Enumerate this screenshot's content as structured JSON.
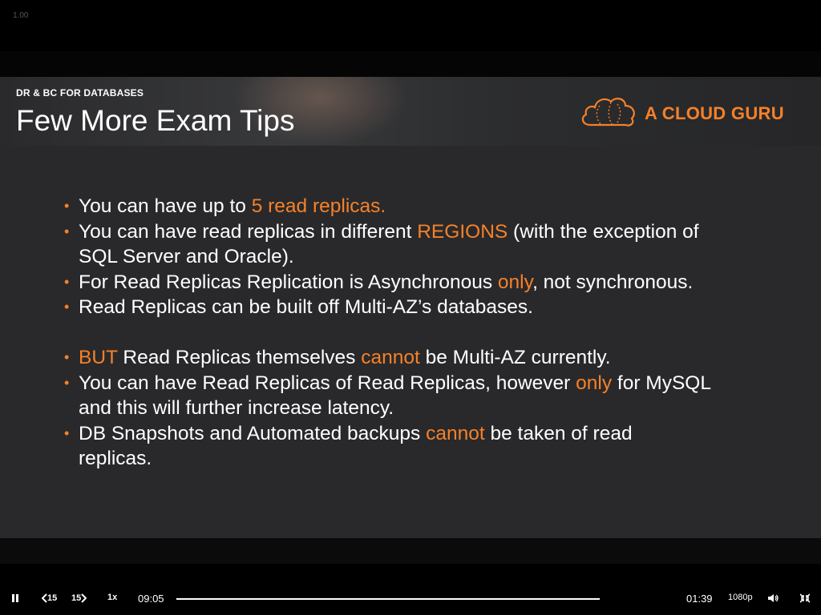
{
  "player": {
    "zoom": "1.00",
    "speed": "1x",
    "elapsed": "09:05",
    "remaining": "01:39",
    "quality": "1080p",
    "skip_back_label": "15",
    "skip_forward_label": "15"
  },
  "slide": {
    "section": "DR & BC FOR DATABASES",
    "title": "Few More Exam Tips",
    "logo_text": "A CLOUD GURU",
    "bullets": [
      {
        "segments": [
          {
            "text": "You can have up to ",
            "hl": false
          },
          {
            "text": "5 read replicas.",
            "hl": true
          }
        ]
      },
      {
        "segments": [
          {
            "text": "You can have read replicas in different ",
            "hl": false
          },
          {
            "text": "REGIONS",
            "hl": true
          },
          {
            "text": " (with the exception of",
            "hl": false
          }
        ]
      },
      {
        "segments": [
          {
            "text": "SQL Server and Oracle).",
            "hl": false
          }
        ],
        "continuation": true
      },
      {
        "segments": [
          {
            "text": "For Read Replicas Replication is Asynchronous ",
            "hl": false
          },
          {
            "text": "only",
            "hl": true
          },
          {
            "text": ", not synchronous.",
            "hl": false
          }
        ]
      },
      {
        "segments": [
          {
            "text": "Read Replicas can be built off Multi-AZ’s databases.",
            "hl": false
          }
        ]
      },
      {
        "segments": [
          {
            "text": "BUT",
            "hl": true
          },
          {
            "text": " Read Replicas themselves ",
            "hl": false
          },
          {
            "text": "cannot",
            "hl": true
          },
          {
            "text": " be Multi-AZ currently.",
            "hl": false
          }
        ],
        "gap": true
      },
      {
        "segments": [
          {
            "text": "You can have Read Replicas of Read Replicas, however ",
            "hl": false
          },
          {
            "text": "only",
            "hl": true
          },
          {
            "text": " for MySQL",
            "hl": false
          }
        ]
      },
      {
        "segments": [
          {
            "text": "and this will further increase latency.",
            "hl": false
          }
        ],
        "continuation": true
      },
      {
        "segments": [
          {
            "text": "DB Snapshots and Automated backups ",
            "hl": false
          },
          {
            "text": "cannot",
            "hl": true
          },
          {
            "text": " be taken of read",
            "hl": false
          }
        ]
      },
      {
        "segments": [
          {
            "text": "replicas.",
            "hl": false
          }
        ],
        "continuation": true
      }
    ]
  },
  "colors": {
    "accent": "#f5812a",
    "content_bg": "#29292b"
  },
  "icons": [
    "pause-icon",
    "skip-back-icon",
    "skip-forward-icon",
    "volume-icon",
    "exit-fullscreen-icon",
    "cloud-logo-icon"
  ]
}
